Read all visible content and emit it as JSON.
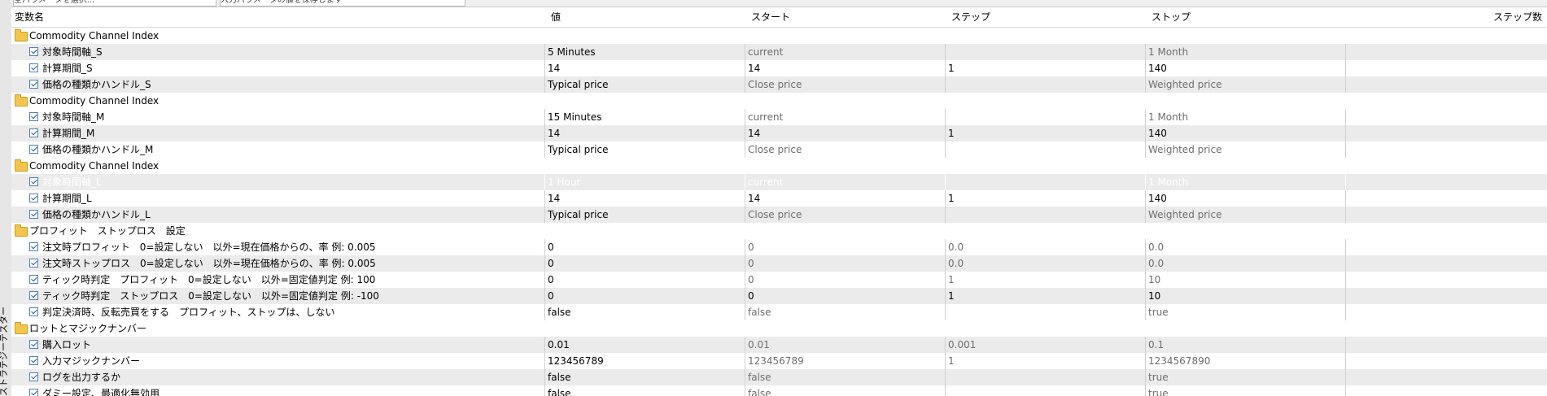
{
  "window": {
    "side_tab_label": "ストラテジーテスター"
  },
  "top_inputs": {
    "left_value": "全パラメータを選択...",
    "right_value": "入力パラメータの値を保存します"
  },
  "columns": {
    "name": "変数名",
    "value": "値",
    "start": "スタート",
    "step": "ステップ",
    "stop": "ストップ",
    "steps": "ステップ数"
  },
  "rows": [
    {
      "kind": "group",
      "name": "Commodity Channel Index"
    },
    {
      "kind": "param",
      "name": "対象時間軸_S",
      "checked": true,
      "value": "5 Minutes",
      "start": "current",
      "step": "",
      "stop": "1 Month",
      "dim": true
    },
    {
      "kind": "param",
      "name": "計算期間_S",
      "checked": true,
      "value": "14",
      "start": "14",
      "step": "1",
      "stop": "140",
      "dim": false
    },
    {
      "kind": "param",
      "name": "価格の種類かハンドル_S",
      "checked": true,
      "value": "Typical price",
      "start": "Close price",
      "step": "",
      "stop": "Weighted price",
      "dim": true
    },
    {
      "kind": "group",
      "name": "Commodity Channel Index"
    },
    {
      "kind": "param",
      "name": "対象時間軸_M",
      "checked": true,
      "value": "15 Minutes",
      "start": "current",
      "step": "",
      "stop": "1 Month",
      "dim": true
    },
    {
      "kind": "param",
      "name": "計算期間_M",
      "checked": true,
      "value": "14",
      "start": "14",
      "step": "1",
      "stop": "140",
      "dim": false
    },
    {
      "kind": "param",
      "name": "価格の種類かハンドル_M",
      "checked": true,
      "value": "Typical price",
      "start": "Close price",
      "step": "",
      "stop": "Weighted price",
      "dim": true
    },
    {
      "kind": "group",
      "name": "Commodity Channel Index"
    },
    {
      "kind": "param",
      "name": "対象時間軸_L",
      "checked": true,
      "value": "1 Hour",
      "start": "current",
      "step": "",
      "stop": "1 Month",
      "dim": true,
      "selected": true
    },
    {
      "kind": "param",
      "name": "計算期間_L",
      "checked": true,
      "value": "14",
      "start": "14",
      "step": "1",
      "stop": "140",
      "dim": false
    },
    {
      "kind": "param",
      "name": "価格の種類かハンドル_L",
      "checked": true,
      "value": "Typical price",
      "start": "Close price",
      "step": "",
      "stop": "Weighted price",
      "dim": true
    },
    {
      "kind": "group",
      "name": "プロフィット　ストップロス　設定"
    },
    {
      "kind": "param",
      "name": "注文時プロフィット　0=設定しない　以外=現在価格からの、率 例: 0.005",
      "checked": true,
      "value": "0",
      "start": "0",
      "step": "0.0",
      "stop": "0.0",
      "dim": true
    },
    {
      "kind": "param",
      "name": "注文時ストップロス　0=設定しない　以外=現在価格からの、率 例: 0.005",
      "checked": true,
      "value": "0",
      "start": "0",
      "step": "0.0",
      "stop": "0.0",
      "dim": true
    },
    {
      "kind": "param",
      "name": "ティック時判定　プロフィット　0=設定しない　以外=固定値判定 例: 100",
      "checked": true,
      "value": "0",
      "start": "0",
      "step": "1",
      "stop": "10",
      "dim": true
    },
    {
      "kind": "param",
      "name": "ティック時判定　ストップロス　0=設定しない　以外=固定値判定 例: -100",
      "checked": true,
      "value": "0",
      "start": "0",
      "step": "1",
      "stop": "10",
      "dim": false
    },
    {
      "kind": "param",
      "name": "判定決済時、反転売買をする　プロフィット、ストップは、しない",
      "checked": true,
      "value": "false",
      "start": "false",
      "step": "",
      "stop": "true",
      "dim": true
    },
    {
      "kind": "group",
      "name": "ロットとマジックナンバー"
    },
    {
      "kind": "param",
      "name": "購入ロット",
      "checked": true,
      "value": "0.01",
      "start": "0.01",
      "step": "0.001",
      "stop": "0.1",
      "dim": true
    },
    {
      "kind": "param",
      "name": "入力マジックナンバー",
      "checked": true,
      "value": "123456789",
      "start": "123456789",
      "step": "1",
      "stop": "1234567890",
      "dim": true
    },
    {
      "kind": "param",
      "name": "ログを出力するか",
      "checked": true,
      "value": "false",
      "start": "false",
      "step": "",
      "stop": "true",
      "dim": true
    },
    {
      "kind": "param",
      "name": "ダミー設定、最適化無効用",
      "checked": true,
      "value": "false",
      "start": "false",
      "step": "",
      "stop": "true",
      "dim": true
    }
  ]
}
